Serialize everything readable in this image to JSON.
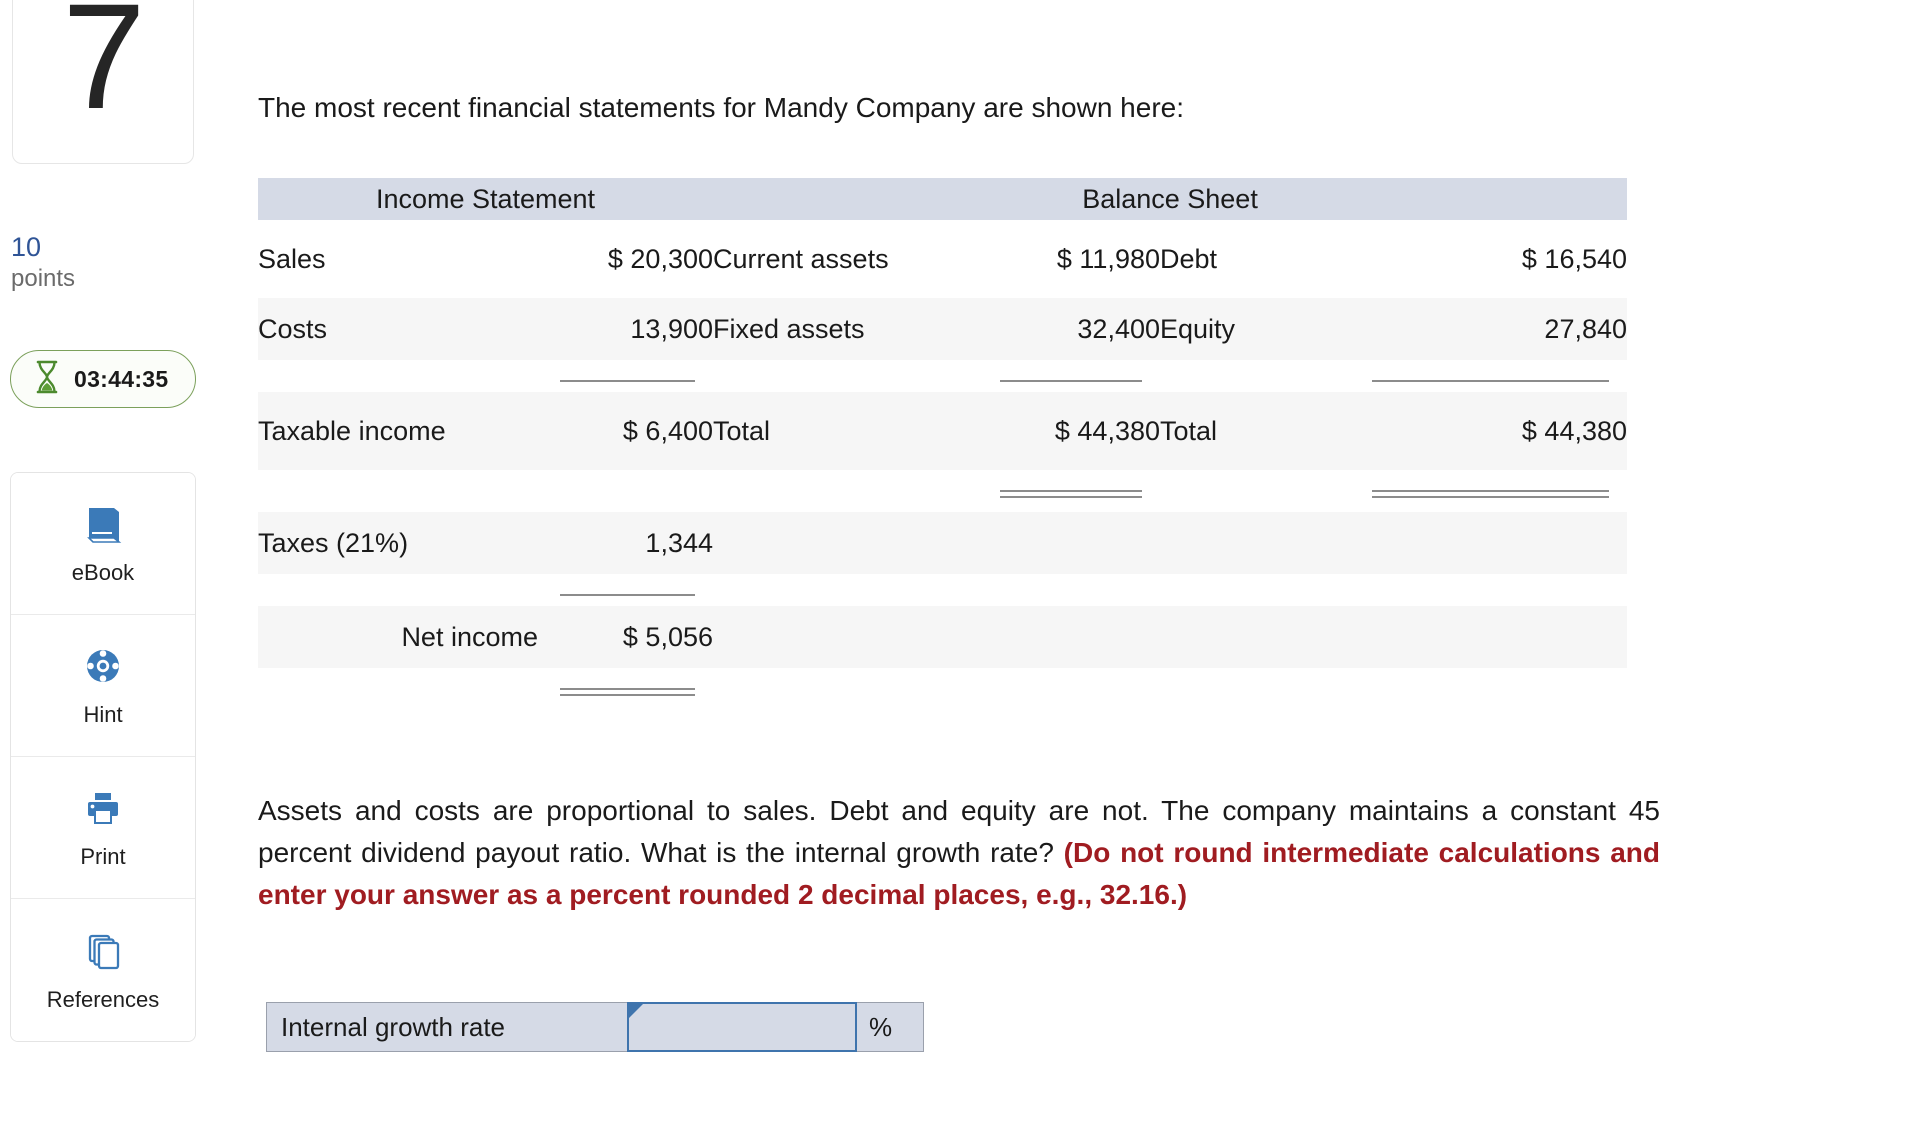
{
  "sidebar": {
    "question_number": "7",
    "points_value": "10",
    "points_label": "points",
    "timer": "03:44:35",
    "timer_icon": "hourglass-icon",
    "tools": [
      {
        "label": "eBook",
        "icon": "book-icon"
      },
      {
        "label": "Hint",
        "icon": "life-ring-icon"
      },
      {
        "label": "Print",
        "icon": "printer-icon"
      },
      {
        "label": "References",
        "icon": "stacked-pages-icon"
      }
    ]
  },
  "main": {
    "intro": "The most recent financial statements for Mandy Company are shown here:",
    "question_part1": "Assets and costs are proportional to sales. Debt and equity are not. The company maintains a constant 45 percent dividend payout ratio. What is the internal growth rate?",
    "question_part2": "(Do not round intermediate calculations and enter your answer as a percent rounded 2 decimal places, e.g., 32.16.)"
  },
  "table": {
    "header_income": "Income Statement",
    "header_balance": "Balance Sheet",
    "rows": {
      "sales_label": "Sales",
      "sales_value": "$ 20,300",
      "costs_label": "Costs",
      "costs_value": "13,900",
      "current_assets_label": "Current assets",
      "current_assets_value": "$ 11,980",
      "fixed_assets_label": "Fixed assets",
      "fixed_assets_value": "32,400",
      "debt_label": "Debt",
      "debt_value": "$ 16,540",
      "equity_label": "Equity",
      "equity_value": "27,840",
      "taxable_income_label": "Taxable income",
      "taxable_income_value": "$ 6,400",
      "total_assets_label": "Total",
      "total_assets_value": "$ 44,380",
      "total_liab_label": "Total",
      "total_liab_value": "$ 44,380",
      "taxes_label": "Taxes (21%)",
      "taxes_value": "1,344",
      "net_income_label": "Net income",
      "net_income_value": "$ 5,056"
    }
  },
  "answer": {
    "label": "Internal growth rate",
    "value": "",
    "placeholder": "",
    "unit": "%"
  },
  "colors": {
    "header_bg": "#d5dae6",
    "row_stripe": "#f6f6f6",
    "red_instruction": "#a01c21",
    "accent_blue": "#3f74ad",
    "points_blue": "#2f5496",
    "timer_green": "#7ba05b"
  }
}
